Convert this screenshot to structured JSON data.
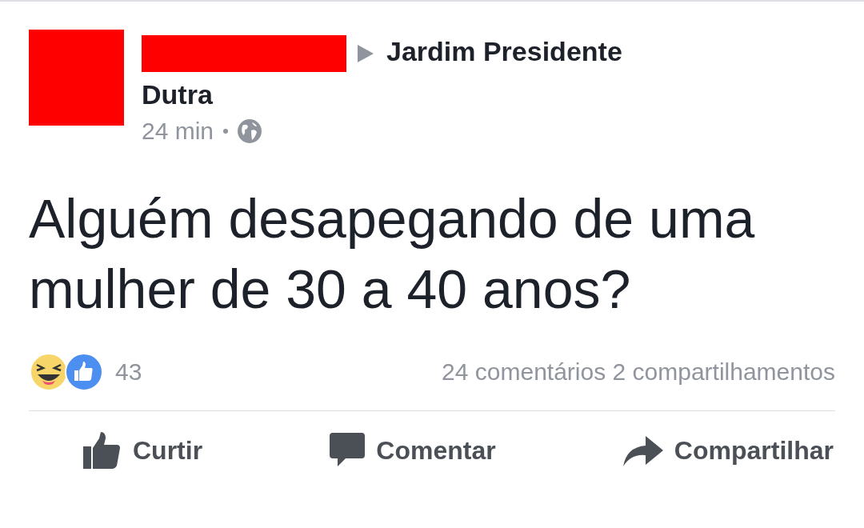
{
  "post": {
    "location_lines": [
      "Jardim Presidente",
      "Dutra"
    ],
    "time": "24 min",
    "text": "Alguém desapegando de uma mulher de 30 a 40 anos?",
    "reactions_count": "43",
    "comments": "24 comentários",
    "shares": "2 compartilhamentos",
    "actions": [
      {
        "kind": "like",
        "label": "Curtir"
      },
      {
        "kind": "comment",
        "label": "Comentar"
      },
      {
        "kind": "share",
        "label": "Compartilhar"
      }
    ]
  }
}
